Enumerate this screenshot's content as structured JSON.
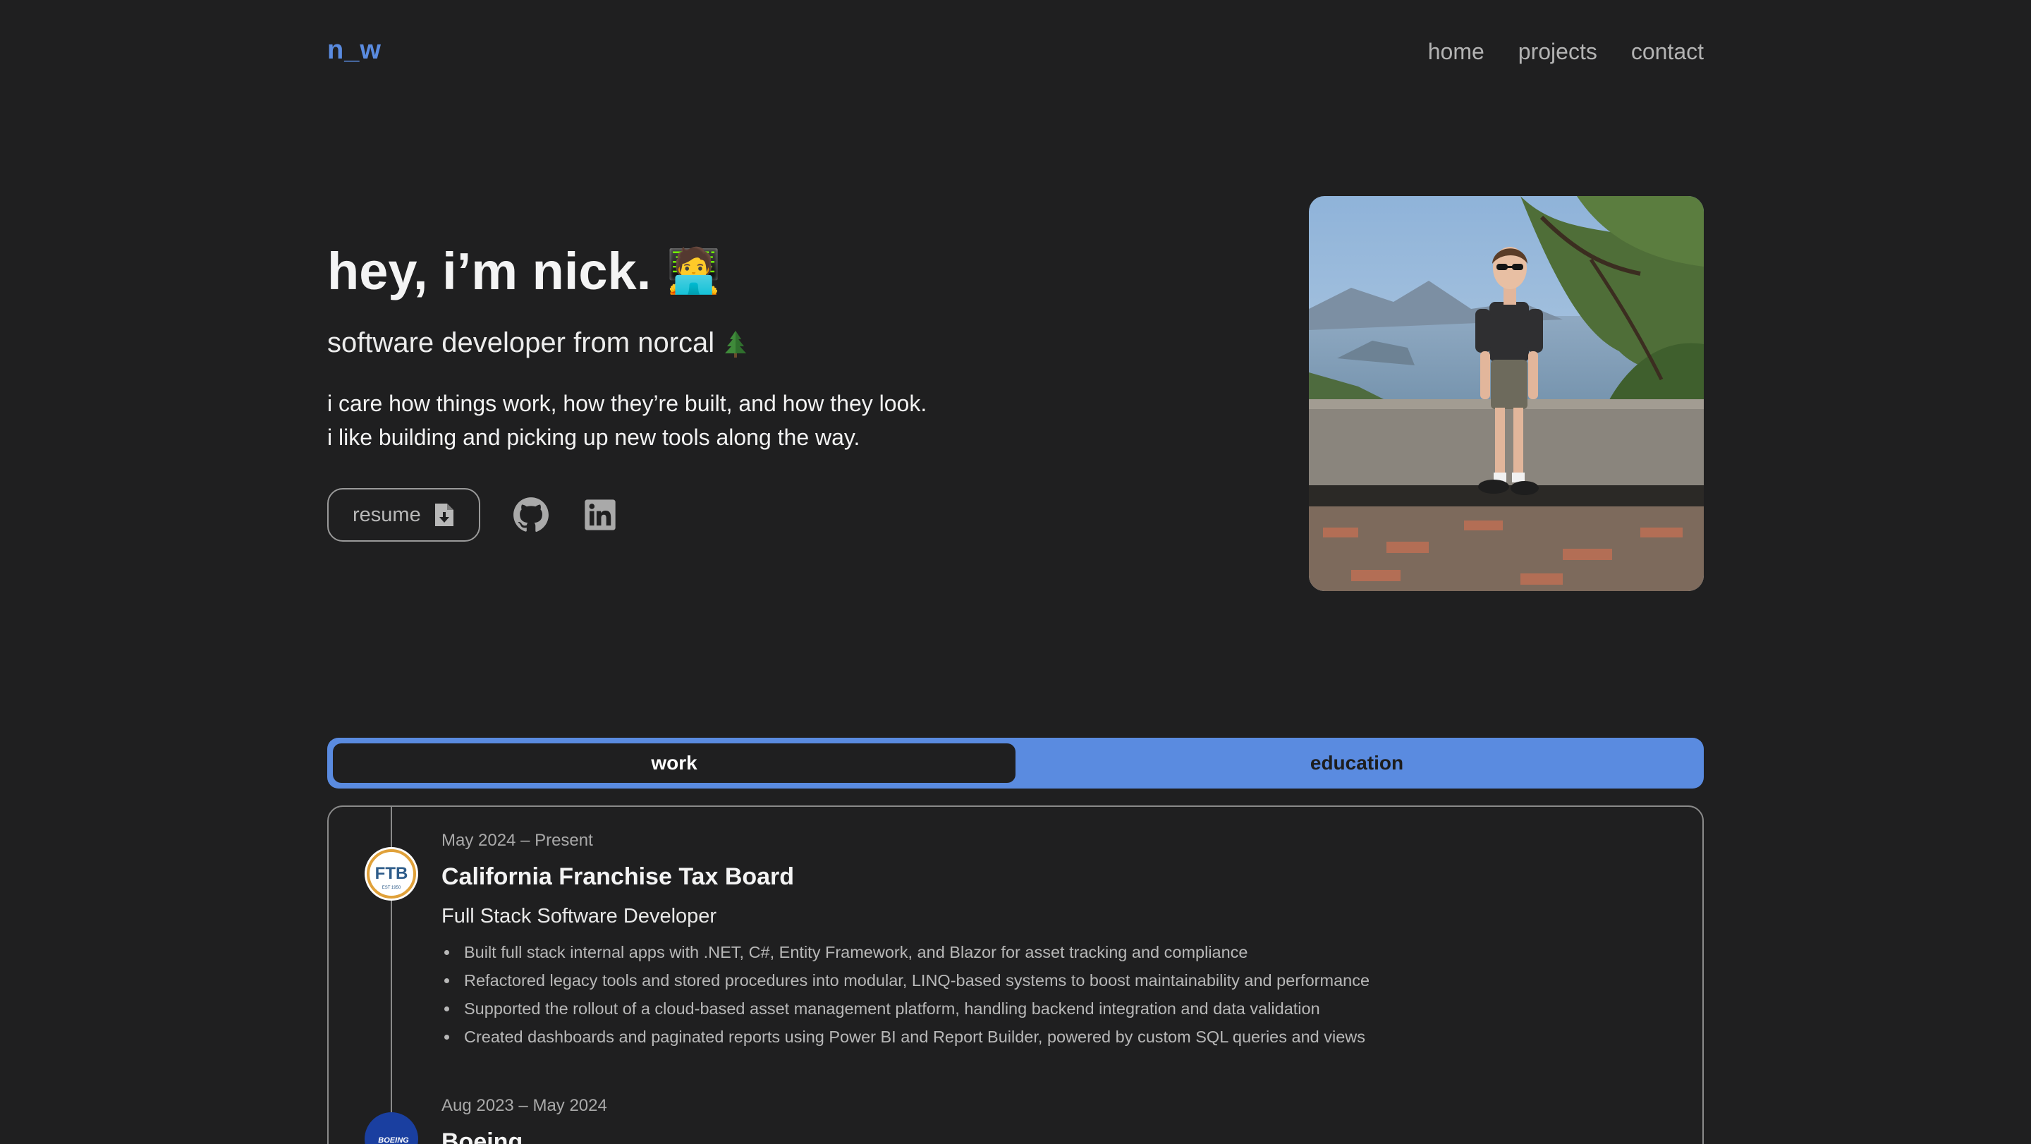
{
  "header": {
    "logo": "n_w",
    "nav": [
      "home",
      "projects",
      "contact"
    ]
  },
  "hero": {
    "title": "hey, i’m nick.",
    "title_emoji": "🧑‍💻",
    "subtitle": "software developer from norcal",
    "subtitle_icon": "evergreen-tree-icon",
    "bio_lines": [
      "i care how things work, how they’re built, and how they look.",
      "i like building and picking up new tools along the way."
    ],
    "resume_label": "resume",
    "social_icons": [
      "github-icon",
      "linkedin-icon"
    ]
  },
  "tabs": {
    "items": [
      "work",
      "education"
    ],
    "active": "work"
  },
  "experience": [
    {
      "date": "May 2024 – Present",
      "company": "California Franchise Tax Board",
      "logo_text": "FTB",
      "logo_subtext": "EST 1950",
      "role": "Full Stack Software Developer",
      "bullets": [
        "Built full stack internal apps with .NET, C#, Entity Framework, and Blazor for asset tracking and compliance",
        "Refactored legacy tools and stored procedures into modular, LINQ-based systems to boost maintainability and performance",
        "Supported the rollout of a cloud-based asset management platform, handling backend integration and data validation",
        "Created dashboards and paginated reports using Power BI and Report Builder, powered by custom SQL queries and views"
      ]
    },
    {
      "date": "Aug 2023 – May 2024",
      "company": "Boeing",
      "logo_text": "BOEING"
    }
  ],
  "colors": {
    "background": "#1f1f20",
    "accent": "#5a8be0",
    "muted_text": "#b3b3b3",
    "border": "#8a8a8a"
  }
}
